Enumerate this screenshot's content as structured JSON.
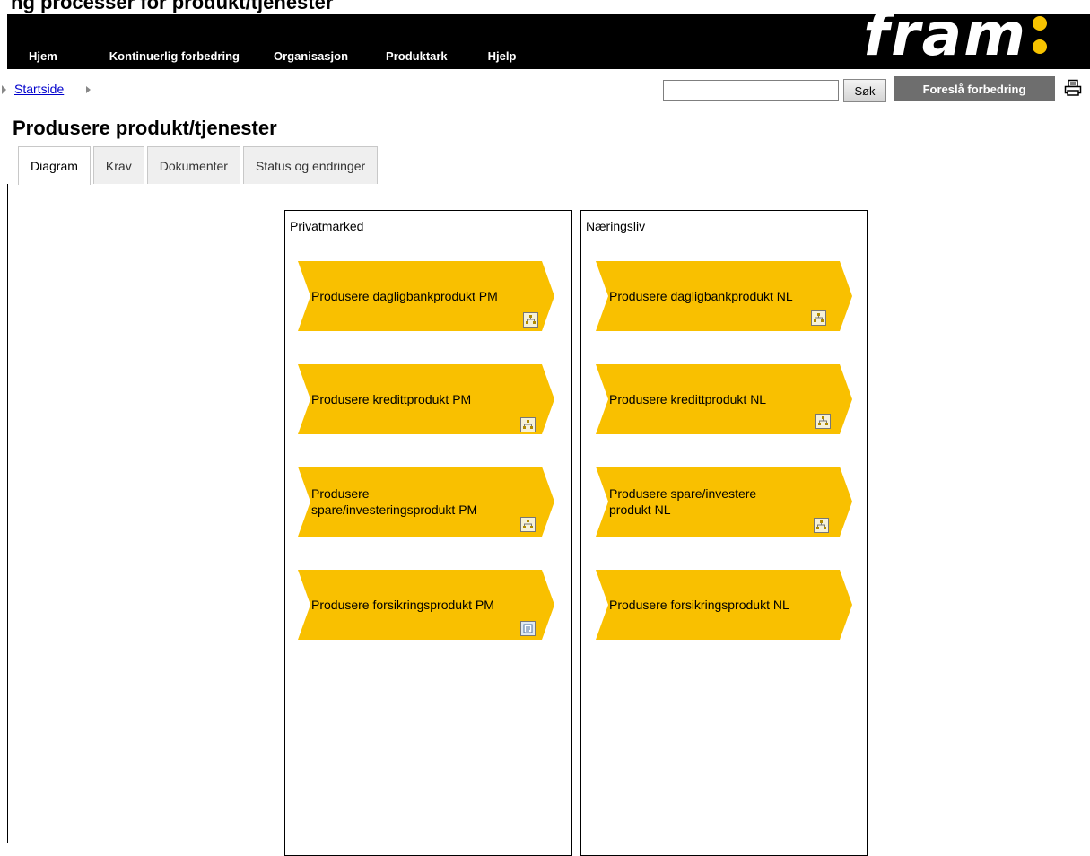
{
  "top_cropped_text": "ng          processer for produkt/tjenester",
  "header": {
    "nav": [
      "Hjem",
      "Kontinuerlig forbedring",
      "Organisasjon",
      "Produktark",
      "Hjelp"
    ],
    "logo_text": "fram"
  },
  "breadcrumb": {
    "label": "Startside"
  },
  "search": {
    "value": "",
    "button_label": "Søk"
  },
  "suggest_button_label": "Foreslå forbedring",
  "page_title": "Produsere produkt/tjenester",
  "tabs": [
    {
      "label": "Diagram",
      "active": true
    },
    {
      "label": "Krav",
      "active": false
    },
    {
      "label": "Dokumenter",
      "active": false
    },
    {
      "label": "Status og endringer",
      "active": false
    }
  ],
  "diagram": {
    "process_color": "#f9c000",
    "lanes": [
      {
        "title": "Privatmarked",
        "processes": [
          {
            "label_lines": [
              "Produsere dagligbankprodukt PM"
            ],
            "icon": "process-model-icon"
          },
          {
            "label_lines": [
              "Produsere kredittprodukt PM"
            ],
            "icon": "process-model-icon"
          },
          {
            "label_lines": [
              "Produsere",
              "spare/investeringsprodukt PM"
            ],
            "icon": "process-model-icon"
          },
          {
            "label_lines": [
              "Produsere forsikringsprodukt PM"
            ],
            "icon": "document-icon"
          }
        ]
      },
      {
        "title": "Næringsliv",
        "processes": [
          {
            "label_lines": [
              "Produsere dagligbankprodukt NL"
            ],
            "icon": "process-model-icon"
          },
          {
            "label_lines": [
              "Produsere kredittprodukt NL"
            ],
            "icon": "process-model-icon"
          },
          {
            "label_lines": [
              "Produsere spare/investere",
              "produkt NL"
            ],
            "icon": "process-model-icon"
          },
          {
            "label_lines": [
              "Produsere forsikringsprodukt NL"
            ],
            "icon": null
          }
        ]
      }
    ]
  }
}
